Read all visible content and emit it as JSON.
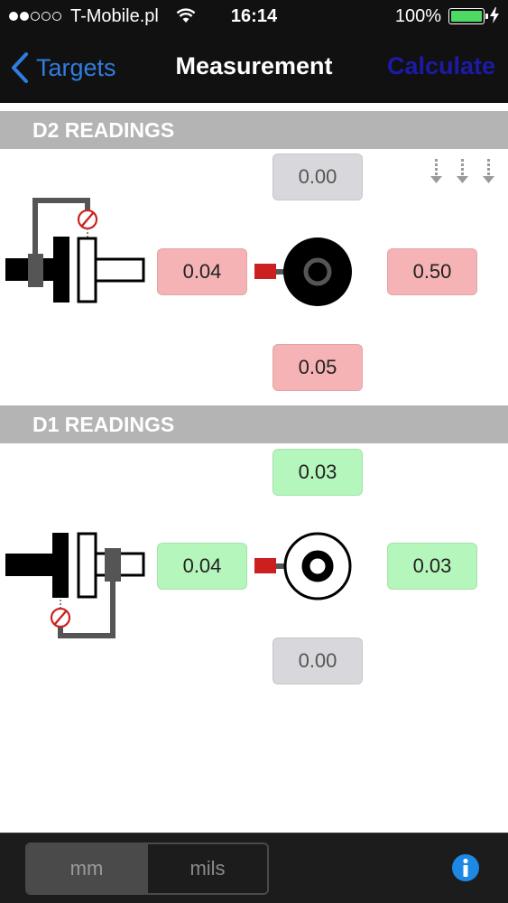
{
  "status_bar": {
    "carrier": "T-Mobile.pl",
    "time": "16:14",
    "battery_percent": "100%",
    "signal_bars_filled": 2,
    "signal_bars_total": 5
  },
  "nav": {
    "back_label": "Targets",
    "title": "Measurement",
    "calculate_label": "Calculate"
  },
  "d2": {
    "header": "D2 READINGS",
    "top": "0.00",
    "left": "0.04",
    "right": "0.50",
    "bottom": "0.05"
  },
  "d1": {
    "header": "D1 READINGS",
    "top": "0.03",
    "left": "0.04",
    "right": "0.03",
    "bottom": "0.00"
  },
  "units": {
    "mm_label": "mm",
    "mils_label": "mils",
    "selected": "mm"
  },
  "colors": {
    "nav_background": "#111111",
    "back_blue": "#2f7de1",
    "calculate_blue": "#1d1aa8",
    "section_header": "#b4b4b4",
    "reading_gray": "#d8d8dc",
    "reading_red": "#f6b3b5",
    "reading_green": "#b4f6bb",
    "info_blue": "#1e88e5"
  }
}
